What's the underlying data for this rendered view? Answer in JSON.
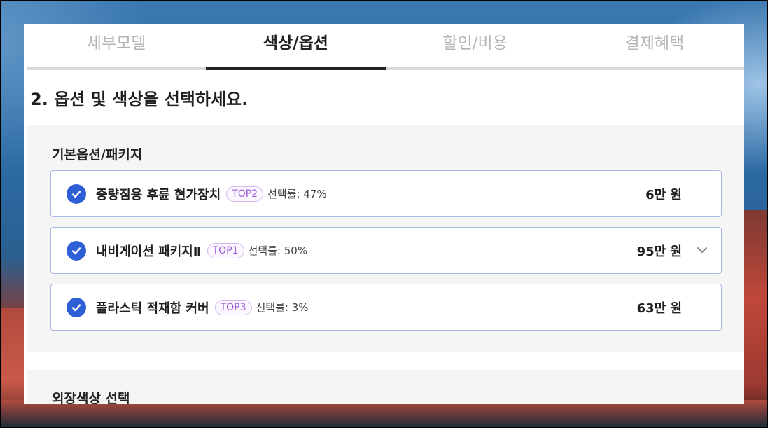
{
  "tabs": [
    {
      "label": "세부모델",
      "active": false
    },
    {
      "label": "색상/옵션",
      "active": true
    },
    {
      "label": "할인/비용",
      "active": false
    },
    {
      "label": "결제혜택",
      "active": false
    }
  ],
  "heading": "2. 옵션 및 색상을 선택하세요.",
  "basic_options": {
    "title": "기본옵션/패키지",
    "items": [
      {
        "name": "중량짐용 후륜 현가장치",
        "badge": "TOP2",
        "rate": "선택률: 47%",
        "price": "6만 원",
        "checked": true,
        "expandable": false
      },
      {
        "name": "내비게이션 패키지Ⅱ",
        "badge": "TOP1",
        "rate": "선택률: 50%",
        "price": "95만 원",
        "checked": true,
        "expandable": true
      },
      {
        "name": "플라스틱 적재함 커버",
        "badge": "TOP3",
        "rate": "선택률: 3%",
        "price": "63만 원",
        "checked": true,
        "expandable": false
      }
    ]
  },
  "exterior_color": {
    "title": "외장색상 선택"
  },
  "colors": {
    "accent_check": "#2f5fd6",
    "badge_text": "#9b5ad6",
    "option_border": "#a9b8e6",
    "active_tab": "#222222",
    "inactive_tab": "#b5b5b5"
  }
}
